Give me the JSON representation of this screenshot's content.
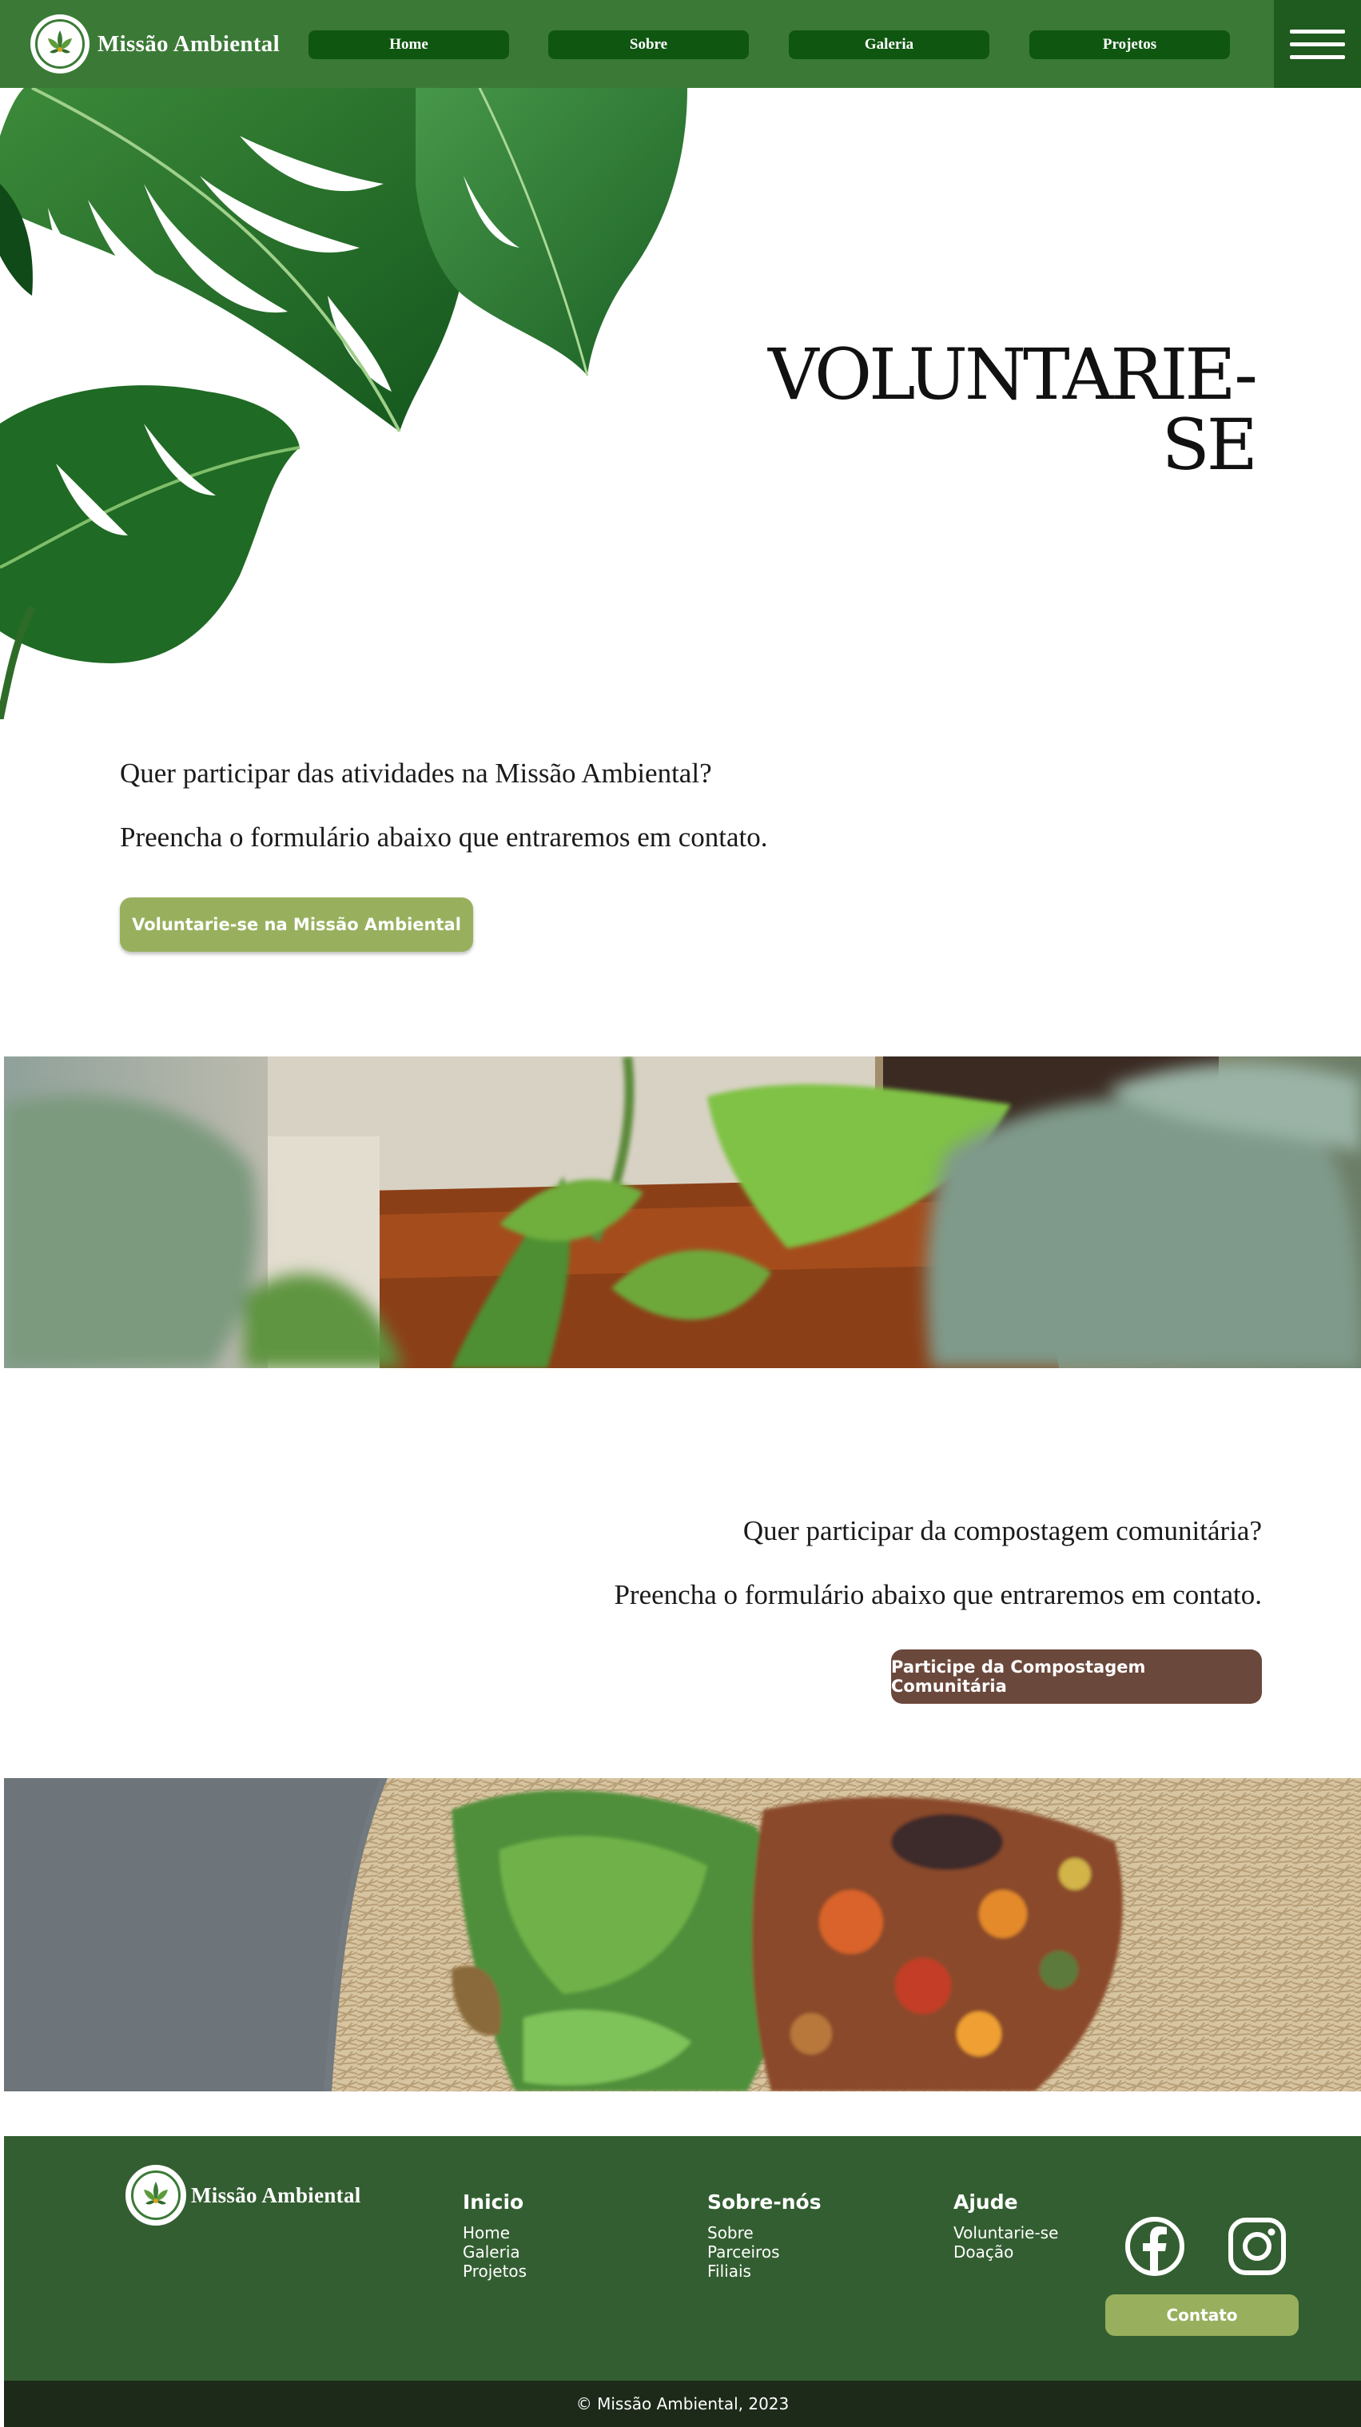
{
  "header": {
    "brand_name": "Missão Ambiental",
    "nav": [
      "Home",
      "Sobre",
      "Galeria",
      "Projetos"
    ],
    "menu_icon": "hamburger-menu-icon"
  },
  "hero": {
    "title": "VOLUNTARIE-SE",
    "image": "monstera-leaves"
  },
  "volunteer": {
    "line1": "Quer participar das atividades na Missão Ambiental?",
    "line2": "Preencha o formulário abaixo que entraremos em contato.",
    "button": "Voluntarie-se na Missão Ambiental",
    "image": "garden-plants-photo"
  },
  "compost": {
    "line1": "Quer participar da compostagem comunitária?",
    "line2": "Preencha o formulário abaixo que entraremos em contato.",
    "button": "Participe da Compostagem Comunitária",
    "image": "compost-pile-photo"
  },
  "footer": {
    "brand_name": "Missão Ambiental",
    "columns": [
      {
        "title": "Inicio",
        "links": [
          "Home",
          "Galeria",
          "Projetos"
        ]
      },
      {
        "title": "Sobre-nós",
        "links": [
          "Sobre",
          "Parceiros",
          "Filiais"
        ]
      },
      {
        "title": "Ajude",
        "links": [
          "Voluntarie-se",
          "Doação"
        ]
      }
    ],
    "social_icons": [
      "facebook-icon",
      "instagram-icon"
    ],
    "contact_button": "Contato",
    "copyright": "© Missão Ambiental, 2023"
  },
  "colors": {
    "header_green": "#3b7a36",
    "nav_button": "#0f5610",
    "menu_box": "#1f5a1e",
    "accent_green": "#98b05e",
    "brown_button": "#6b483c",
    "footer_green": "#335e31",
    "copyright_bar": "#1d2a1a"
  }
}
